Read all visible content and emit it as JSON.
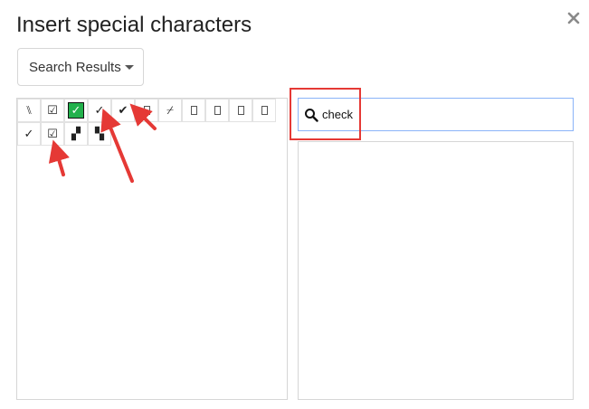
{
  "dialog": {
    "title": "Insert special characters",
    "close_icon": "close-icon"
  },
  "category_dropdown": {
    "selected": "Search Results"
  },
  "search": {
    "value": "check",
    "icon": "search-icon"
  },
  "characters": [
    {
      "glyph": "⑊",
      "kind": "text"
    },
    {
      "glyph": "☑",
      "kind": "text"
    },
    {
      "glyph": "✓",
      "kind": "green-box"
    },
    {
      "glyph": "✓",
      "kind": "text"
    },
    {
      "glyph": "✔",
      "kind": "text"
    },
    {
      "glyph": "",
      "kind": "tofu"
    },
    {
      "glyph": "⌿",
      "kind": "text"
    },
    {
      "glyph": "",
      "kind": "tofu"
    },
    {
      "glyph": "",
      "kind": "tofu"
    },
    {
      "glyph": "",
      "kind": "tofu"
    },
    {
      "glyph": "",
      "kind": "tofu"
    },
    {
      "glyph": "✓",
      "kind": "text"
    },
    {
      "glyph": "☑",
      "kind": "text"
    },
    {
      "glyph": "▞",
      "kind": "text"
    },
    {
      "glyph": "▚",
      "kind": "text"
    }
  ],
  "colors": {
    "annotation_red": "#e53935",
    "checkbox_green": "#22b14c",
    "input_focus_border": "#8ab4f8"
  }
}
